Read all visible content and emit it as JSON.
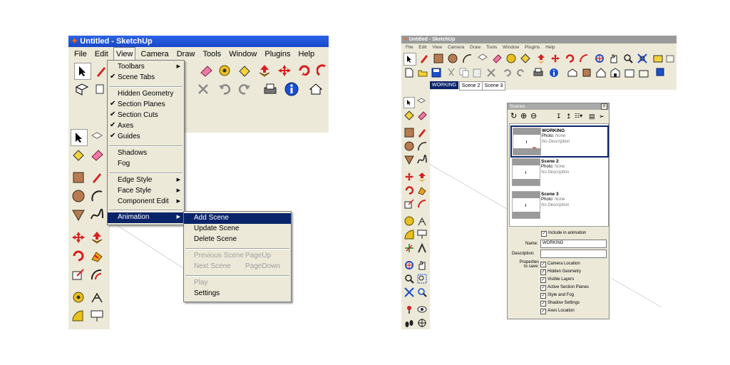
{
  "left_window": {
    "title": "Untitled - SketchUp",
    "menus": [
      "File",
      "Edit",
      "View",
      "Camera",
      "Draw",
      "Tools",
      "Window",
      "Plugins",
      "Help"
    ],
    "view_menu": [
      {
        "label": "Toolbars",
        "checked": false,
        "submenu": true
      },
      {
        "label": "Scene Tabs",
        "checked": true,
        "submenu": false
      },
      {
        "label": "Hidden Geometry",
        "checked": false,
        "submenu": false
      },
      {
        "label": "Section Planes",
        "checked": true,
        "submenu": false
      },
      {
        "label": "Section Cuts",
        "checked": true,
        "submenu": false
      },
      {
        "label": "Axes",
        "checked": true,
        "submenu": false
      },
      {
        "label": "Guides",
        "checked": true,
        "submenu": false
      },
      {
        "label": "Shadows",
        "checked": false,
        "submenu": false
      },
      {
        "label": "Fog",
        "checked": false,
        "submenu": false
      },
      {
        "label": "Edge Style",
        "checked": false,
        "submenu": true
      },
      {
        "label": "Face Style",
        "checked": false,
        "submenu": true
      },
      {
        "label": "Component Edit",
        "checked": false,
        "submenu": true
      },
      {
        "label": "Animation",
        "checked": false,
        "submenu": true
      }
    ],
    "animation_menu": [
      {
        "label": "Add Scene",
        "shortcut": ""
      },
      {
        "label": "Update Scene",
        "shortcut": ""
      },
      {
        "label": "Delete Scene",
        "shortcut": ""
      },
      {
        "label": "Previous Scene",
        "shortcut": "PageUp"
      },
      {
        "label": "Next Scene",
        "shortcut": "PageDown"
      },
      {
        "label": "Play",
        "shortcut": ""
      },
      {
        "label": "Settings",
        "shortcut": ""
      }
    ],
    "toolbar_icons": [
      "select-arrow-icon",
      "pencil-icon",
      "eraser-icon",
      "tape-measure-icon",
      "paint-bucket-icon",
      "push-pull-icon",
      "move-icon",
      "rotate-icon",
      "orbit-icon",
      "cross-icon",
      "undo-icon",
      "redo-icon",
      "print-icon",
      "info-icon",
      "house-icon"
    ],
    "side_toolbar_icons": [
      "select-arrow-icon",
      "component-icon",
      "paint-bucket-icon",
      "eraser-icon",
      "rectangle-icon",
      "pencil-icon",
      "circle-icon",
      "arc-icon",
      "polygon-icon",
      "freehand-icon",
      "move-icon",
      "push-pull-icon",
      "rotate-icon",
      "follow-me-icon",
      "scale-icon",
      "offset-icon",
      "tape-measure-icon",
      "dimension-icon",
      "protractor-icon",
      "text-icon"
    ]
  },
  "right_window": {
    "title": "Untitled - SketchUp",
    "menus": [
      "File",
      "Edit",
      "View",
      "Camera",
      "Draw",
      "Tools",
      "Window",
      "Plugins",
      "Help"
    ],
    "scene_tabs": [
      "WORKING",
      "Scene 2",
      "Scene 3"
    ],
    "active_tab": "WORKING",
    "scenes_panel": {
      "title": "Scenes",
      "close": "x",
      "toolbar_icons": [
        "refresh-icon",
        "add-icon",
        "remove-icon",
        "move-down-icon",
        "move-up-icon",
        "view-options-icon",
        "details-icon",
        "arrow-right-icon"
      ],
      "scenes": [
        {
          "name": "WORKING",
          "photo_label": "Photo:",
          "photo_value": "None",
          "description": "No Description",
          "selected": true
        },
        {
          "name": "Scene 2",
          "photo_label": "Photo:",
          "photo_value": "None",
          "description": "No Description",
          "selected": false
        },
        {
          "name": "Scene 3",
          "photo_label": "Photo:",
          "photo_value": "None",
          "description": "No Description",
          "selected": false
        }
      ],
      "include_in_animation": "Include in animation",
      "name_label": "Name:",
      "name_value": "WORKING",
      "description_label": "Description:",
      "description_value": "",
      "properties_label_1": "Properties",
      "properties_label_2": "to save:",
      "properties": [
        "Camera Location",
        "Hidden Geometry",
        "Visible Layers",
        "Active Section Planes",
        "Style and Fog",
        "Shadow Settings",
        "Axes Location"
      ]
    }
  },
  "colors": {
    "titlebar": "#1f4fd6",
    "toolbar_bg": "#ece9d8",
    "highlight": "#0a246a",
    "selection_border": "#0a246a"
  }
}
